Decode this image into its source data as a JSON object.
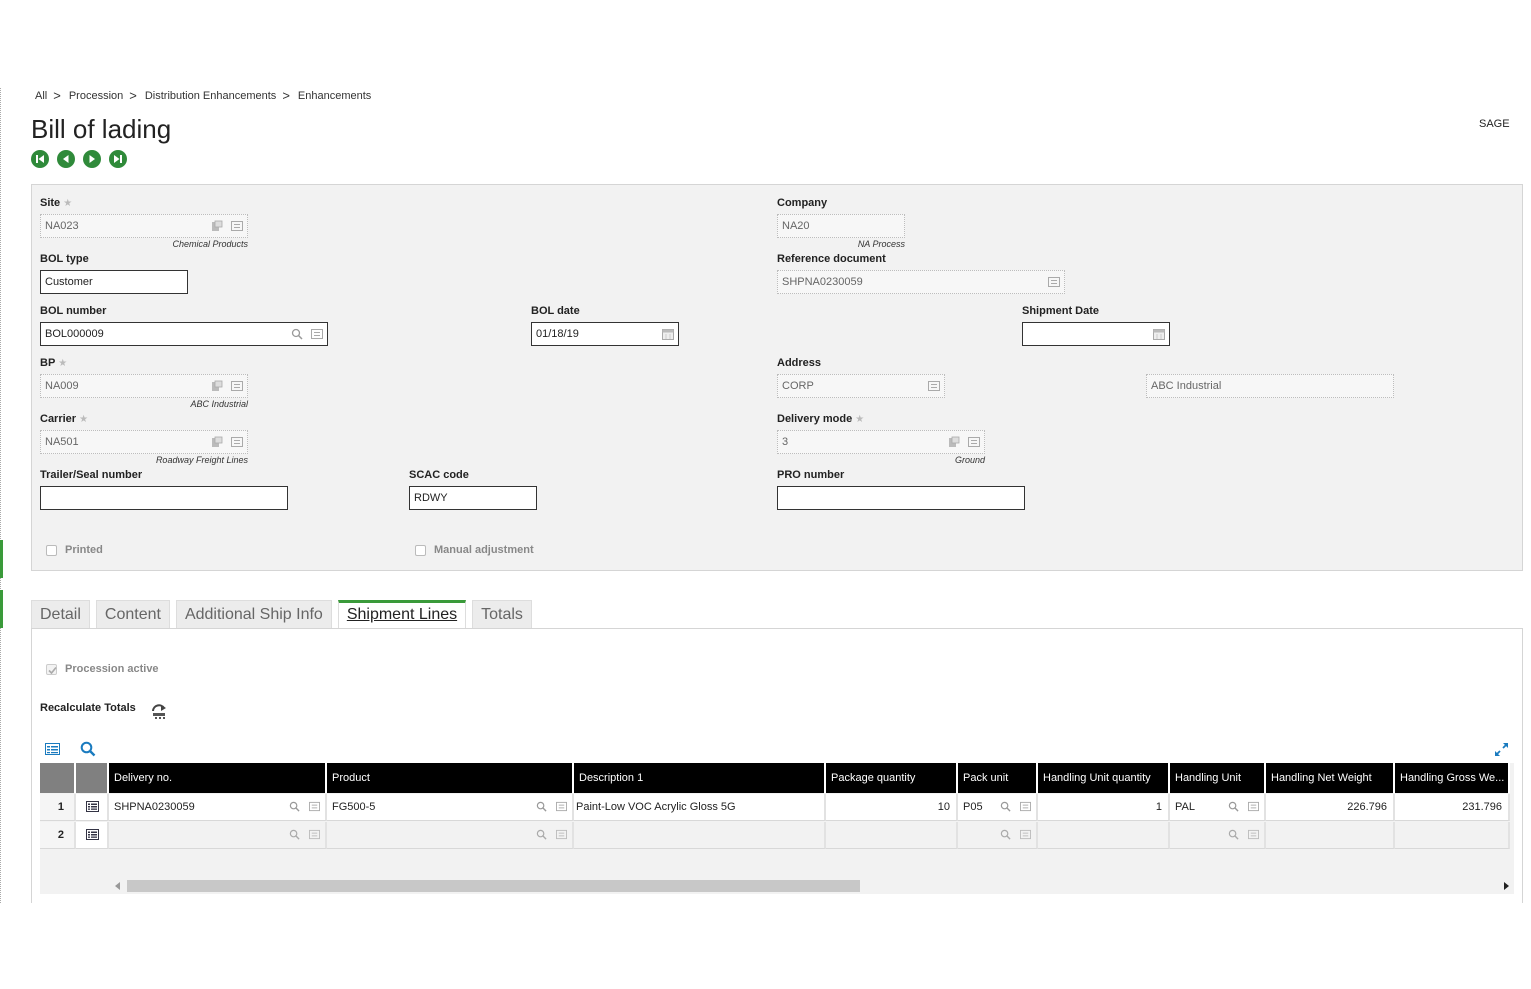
{
  "breadcrumb": [
    {
      "label": "All"
    },
    {
      "label": "Procession"
    },
    {
      "label": "Distribution Enhancements"
    },
    {
      "label": "Enhancements"
    }
  ],
  "breadcrumb_separator": ">",
  "page_title": "Bill of lading",
  "brand": "SAGE",
  "form": {
    "site": {
      "label": "Site",
      "value": "NA023",
      "sub": "Chemical Products"
    },
    "company": {
      "label": "Company",
      "value": "NA20",
      "sub": "NA Process"
    },
    "bol_type": {
      "label": "BOL type",
      "value": "Customer"
    },
    "reference_document": {
      "label": "Reference document",
      "value": "SHPNA0230059"
    },
    "bol_number": {
      "label": "BOL number",
      "value": "BOL000009"
    },
    "bol_date": {
      "label": "BOL date",
      "value": "01/18/19"
    },
    "shipment_date": {
      "label": "Shipment Date",
      "value": ""
    },
    "bp": {
      "label": "BP",
      "value": "NA009",
      "sub": "ABC Industrial"
    },
    "address": {
      "label": "Address",
      "value": "CORP",
      "name": "ABC Industrial"
    },
    "carrier": {
      "label": "Carrier",
      "value": "NA501",
      "sub": "Roadway Freight Lines"
    },
    "delivery_mode": {
      "label": "Delivery mode",
      "value": "3",
      "sub": "Ground"
    },
    "trailer_seal": {
      "label": "Trailer/Seal number",
      "value": ""
    },
    "scac_code": {
      "label": "SCAC code",
      "value": "RDWY"
    },
    "pro_number": {
      "label": "PRO number",
      "value": ""
    },
    "printed": {
      "label": "Printed",
      "checked": false
    },
    "manual_adjustment": {
      "label": "Manual adjustment",
      "checked": false
    }
  },
  "tabs": [
    {
      "label": "Detail",
      "active": false
    },
    {
      "label": "Content",
      "active": false
    },
    {
      "label": "Additional Ship Info",
      "active": false
    },
    {
      "label": "Shipment Lines",
      "active": true
    },
    {
      "label": "Totals",
      "active": false
    }
  ],
  "shipment_lines": {
    "procession_active": {
      "label": "Procession active",
      "checked": true
    },
    "recalculate_label": "Recalculate Totals",
    "columns": [
      "Delivery no.",
      "Product",
      "Description 1",
      "Package quantity",
      "Pack unit",
      "Handling Unit quantity",
      "Handling Unit",
      "Handling Net Weight",
      "Handling Gross We..."
    ],
    "rows": [
      {
        "num": "1",
        "delivery_no": "SHPNA0230059",
        "product": "FG500-5",
        "description": "Paint-Low VOC Acrylic Gloss 5G",
        "package_qty": "10",
        "pack_unit": "P05",
        "hu_qty": "1",
        "hu": "PAL",
        "net_weight": "226.796",
        "gross_weight": "231.796"
      },
      {
        "num": "2",
        "delivery_no": "",
        "product": "",
        "description": "",
        "package_qty": "",
        "pack_unit": "",
        "hu_qty": "",
        "hu": "",
        "net_weight": "",
        "gross_weight": ""
      }
    ]
  },
  "colors": {
    "accent_green": "#2f8a3a",
    "header_black": "#000000",
    "link_blue": "#1a7bbf"
  }
}
